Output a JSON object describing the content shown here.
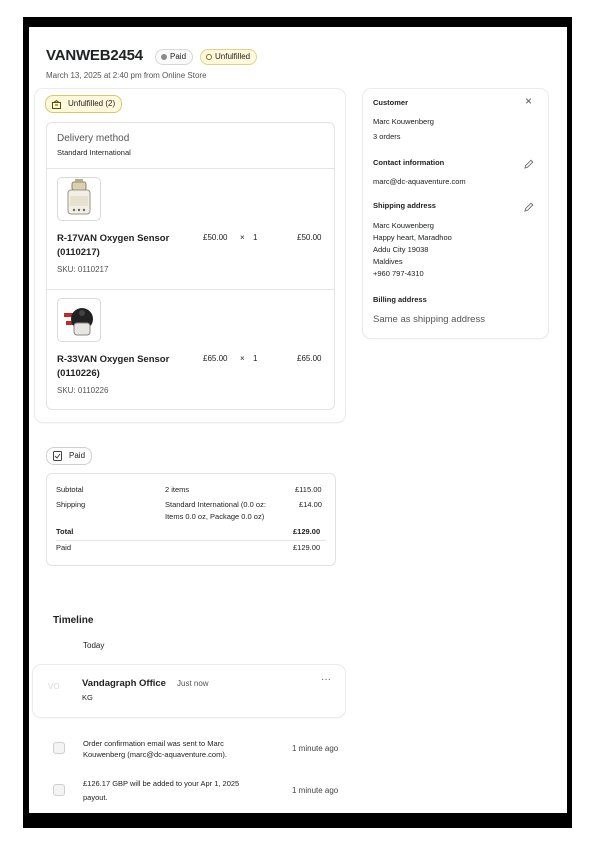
{
  "order": {
    "number": "VANWEB2454",
    "payment_status": "Paid",
    "fulfillment_status": "Unfulfilled",
    "date_line": "March 13, 2025 at 2:40 pm from Online Store"
  },
  "fulfillment": {
    "badge_label": "Unfulfilled (2)",
    "delivery_method_label": "Delivery method",
    "delivery_method_value": "Standard International",
    "items": [
      {
        "name": "R-17VAN Oxygen Sensor (0110217)",
        "sku": "SKU: 0110217",
        "price": "£50.00",
        "times": "×",
        "qty": "1",
        "total": "£50.00",
        "image": "oxygen-sensor-white"
      },
      {
        "name": "R-33VAN Oxygen Sensor (0110226)",
        "sku": "SKU: 0110226",
        "price": "£65.00",
        "times": "×",
        "qty": "1",
        "total": "£65.00",
        "image": "oxygen-sensor-black"
      }
    ]
  },
  "payment": {
    "badge_label": "Paid",
    "rows": {
      "subtotal": {
        "label": "Subtotal",
        "desc": "2 items",
        "amount": "£115.00"
      },
      "shipping": {
        "label": "Shipping",
        "desc_line1": "Standard International (0.0 oz:",
        "desc_line2": "Items 0.0 oz, Package 0.0 oz)",
        "amount": "£14.00"
      },
      "total": {
        "label": "Total",
        "amount": "£129.00"
      },
      "paid": {
        "label": "Paid",
        "amount": "£129.00"
      }
    }
  },
  "timeline": {
    "heading": "Timeline",
    "day_label": "Today",
    "comment": {
      "avatar_initials": "VO",
      "author": "Vandagraph Office",
      "time": "Just now",
      "text": "KG",
      "more": "···"
    },
    "events": [
      {
        "line1": "Order confirmation email was sent to Marc",
        "line2": "Kouwenberg (marc@dc-aquaventure.com).",
        "time": "1 minute ago"
      },
      {
        "line1": "£126.17 GBP will be added to your Apr 1, 2025",
        "line2": "payout.",
        "time": "1 minute ago"
      }
    ]
  },
  "customer": {
    "heading": "Customer",
    "close_icon": "×",
    "name": "Marc Kouwenberg",
    "orders": "3 orders",
    "contact_heading": "Contact information",
    "email": "marc@dc-aquaventure.com",
    "shipping_heading": "Shipping address",
    "address_lines": [
      "Marc Kouwenberg",
      "Happy heart, Maradhoo",
      "Addu City 19038",
      "Maldives",
      "+960 797-4310"
    ],
    "billing_heading": "Billing address",
    "billing_value": "Same as shipping address"
  },
  "colors": {
    "paid_dot": "#8a8a8a",
    "unfulfilled_dot": "#b58a00",
    "unfulfilled_bg": "#fff8db",
    "frame": "#000000"
  }
}
